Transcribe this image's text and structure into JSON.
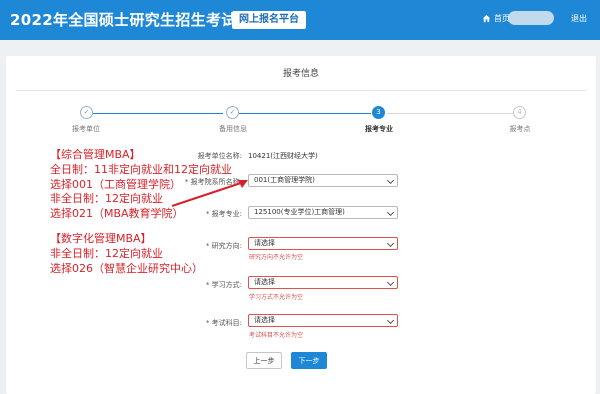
{
  "header": {
    "title": "2022年全国硕士研究生招生考试",
    "platform_badge": "网上报名平台",
    "home_label": "首页",
    "logout_label": "退出",
    "bg_color": "#1f88d6"
  },
  "page": {
    "title": "报考信息"
  },
  "steps": [
    {
      "label": "报考单位",
      "state": "done"
    },
    {
      "label": "备用信息",
      "state": "done"
    },
    {
      "label": "报考专业",
      "state": "active",
      "number": "3"
    },
    {
      "label": "报考点",
      "state": "todo",
      "number": "4"
    }
  ],
  "form": {
    "unit": {
      "label": "报考单位名称:",
      "value": "10421(江西财经大学)"
    },
    "department": {
      "label": "* 报考院系所名称:",
      "value": "001(工商管理学院)"
    },
    "major": {
      "label": "* 报考专业:",
      "value": "125100(专业学位)工商管理)"
    },
    "direction": {
      "label": "* 研究方向:",
      "value": "请选择",
      "error": "研究方向不允许为空"
    },
    "study_mode": {
      "label": "* 学习方式:",
      "value": "请选择",
      "error": "学习方式不允许为空"
    },
    "exam_subject": {
      "label": "* 考试科目:",
      "value": "请选择",
      "error": "考试科目不允许为空"
    }
  },
  "buttons": {
    "prev": "上一步",
    "next": "下一步"
  },
  "annotation": {
    "lines": [
      "【综合管理MBA】",
      "全日制：11非定向就业和12定向就业",
      "选择001（工商管理学院）",
      "非全日制：12定向就业",
      "选择021（MBA教育学院）",
      "【数字化管理MBA】",
      "非全日制：12定向就业",
      "选择026（智慧企业研究中心）"
    ],
    "color": "#d8222a"
  }
}
